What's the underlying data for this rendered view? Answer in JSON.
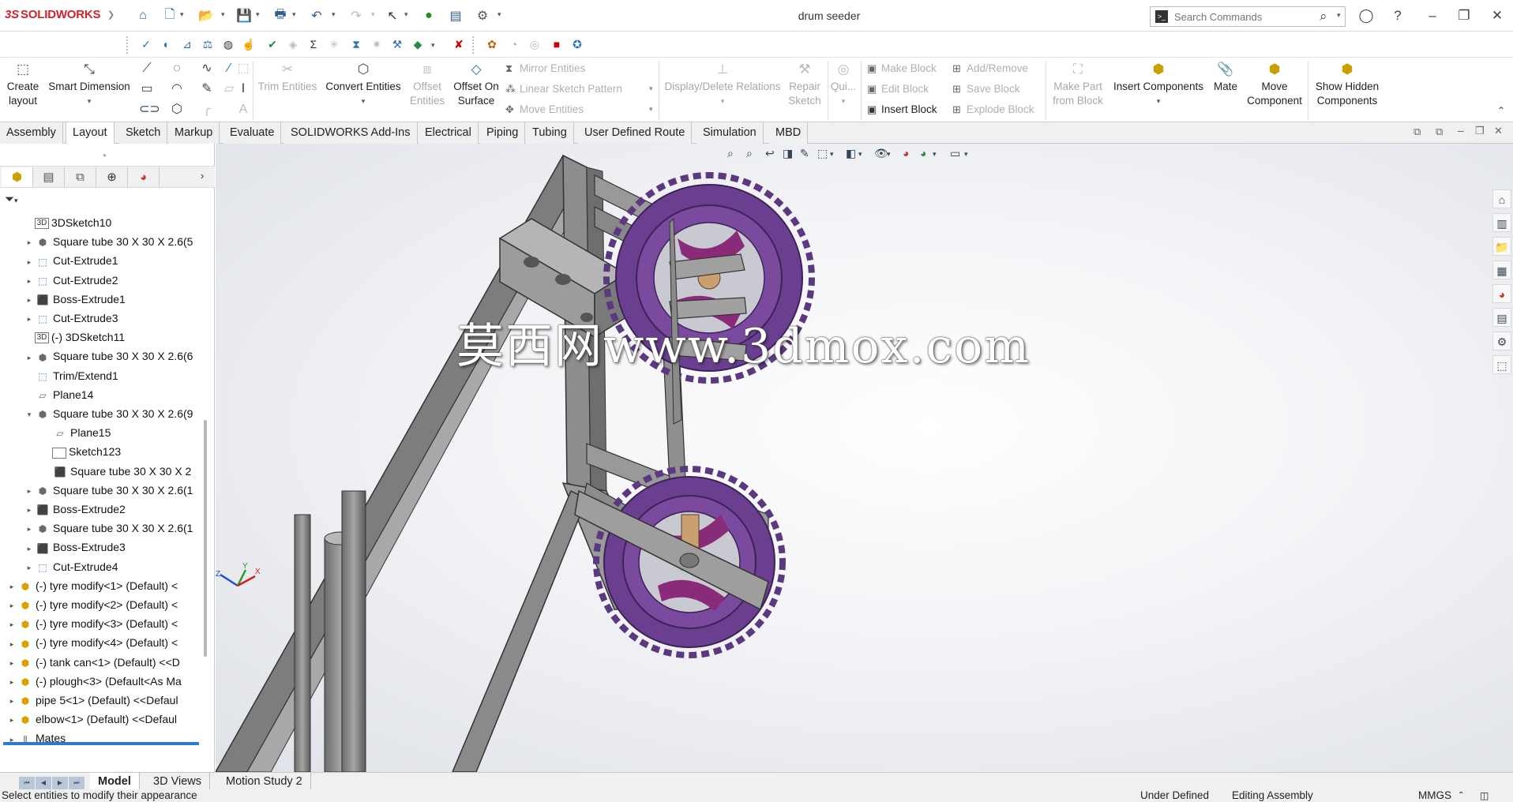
{
  "app": {
    "brand_prefix": "3S",
    "brand": "SOLIDWORKS",
    "document_title": "drum seeder"
  },
  "search": {
    "placeholder": "Search Commands"
  },
  "command_manager": {
    "create_layout": "Create layout",
    "smart_dimension": "Smart Dimension",
    "trim_entities": "Trim Entities",
    "convert_entities": "Convert Entities",
    "offset_entities": "Offset Entities",
    "offset_on_surface": "Offset On Surface",
    "mirror_entities": "Mirror Entities",
    "linear_sketch_pattern": "Linear Sketch Pattern",
    "move_entities": "Move Entities",
    "display_delete_relations": "Display/Delete Relations",
    "repair_sketch": "Repair Sketch",
    "quick_snaps": "Qui...",
    "make_block": "Make Block",
    "edit_block": "Edit Block",
    "insert_block": "Insert Block",
    "add_remove": "Add/Remove",
    "save_block": "Save Block",
    "explode_block": "Explode Block",
    "make_part_from_block": "Make Part from Block",
    "insert_components": "Insert Components",
    "mate": "Mate",
    "move_component": "Move Component",
    "show_hidden_components": "Show Hidden Components"
  },
  "tabs": [
    "Assembly",
    "Layout",
    "Sketch",
    "Markup",
    "Evaluate",
    "SOLIDWORKS Add-Ins",
    "Electrical",
    "Piping",
    "Tubing",
    "User Defined Route",
    "Simulation",
    "MBD"
  ],
  "active_tab": "Layout",
  "feature_tree": [
    {
      "label": "3DSketch10",
      "icon": "sketch-3d-icon"
    },
    {
      "label": "Square tube 30 X 30 X 2.6(5",
      "icon": "part-icon"
    },
    {
      "label": "Cut-Extrude1",
      "icon": "cut-extrude-icon"
    },
    {
      "label": "Cut-Extrude2",
      "icon": "cut-extrude-icon"
    },
    {
      "label": "Boss-Extrude1",
      "icon": "boss-extrude-icon"
    },
    {
      "label": "Cut-Extrude3",
      "icon": "cut-extrude-icon"
    },
    {
      "label": "(-) 3DSketch11",
      "icon": "sketch-3d-icon"
    },
    {
      "label": "Square tube 30 X 30 X 2.6(6",
      "icon": "part-icon"
    },
    {
      "label": "Trim/Extend1",
      "icon": "trim-extend-icon"
    },
    {
      "label": "Plane14",
      "icon": "plane-icon"
    },
    {
      "label": "Square tube 30 X 30 X 2.6(9",
      "icon": "part-icon"
    },
    {
      "label": "Plane15",
      "icon": "plane-icon"
    },
    {
      "label": "Sketch123",
      "icon": "sketch-icon"
    },
    {
      "label": "Square tube 30 X 30 X 2",
      "icon": "body-icon"
    },
    {
      "label": "Square tube 30 X 30 X 2.6(1",
      "icon": "part-icon"
    },
    {
      "label": "Boss-Extrude2",
      "icon": "boss-extrude-icon"
    },
    {
      "label": "Square tube 30 X 30 X 2.6(1",
      "icon": "part-icon"
    },
    {
      "label": "Boss-Extrude3",
      "icon": "boss-extrude-icon"
    },
    {
      "label": "Cut-Extrude4",
      "icon": "cut-extrude-icon"
    },
    {
      "label": "(-) tyre modify<1> (Default) <",
      "icon": "component-icon"
    },
    {
      "label": "(-) tyre modify<2> (Default) <",
      "icon": "component-icon"
    },
    {
      "label": "(-) tyre modify<3> (Default) <",
      "icon": "component-icon"
    },
    {
      "label": "(-) tyre modify<4> (Default) <",
      "icon": "component-icon"
    },
    {
      "label": "(-) tank can<1> (Default) <<D",
      "icon": "component-icon"
    },
    {
      "label": "(-) plough<3> (Default<As Ma",
      "icon": "component-icon"
    },
    {
      "label": "pipe 5<1> (Default) <<Defaul",
      "icon": "component-icon"
    },
    {
      "label": "elbow<1> (Default) <<Defaul",
      "icon": "component-icon"
    },
    {
      "label": "Mates",
      "icon": "mates-icon"
    }
  ],
  "bottom_tabs": [
    "Model",
    "3D Views",
    "Motion Study 2"
  ],
  "active_bottom_tab": "Model",
  "status": {
    "message": "Select entities to modify their appearance",
    "definition": "Under Defined",
    "mode": "Editing Assembly",
    "units": "MMGS"
  },
  "watermark": "莫西网www.3dmox.com",
  "colors": {
    "tyre": "#6b3f8f",
    "tyre_rim": "#8a2b7a",
    "frame": "#8e8e8e",
    "brand_red": "#d2232a"
  }
}
